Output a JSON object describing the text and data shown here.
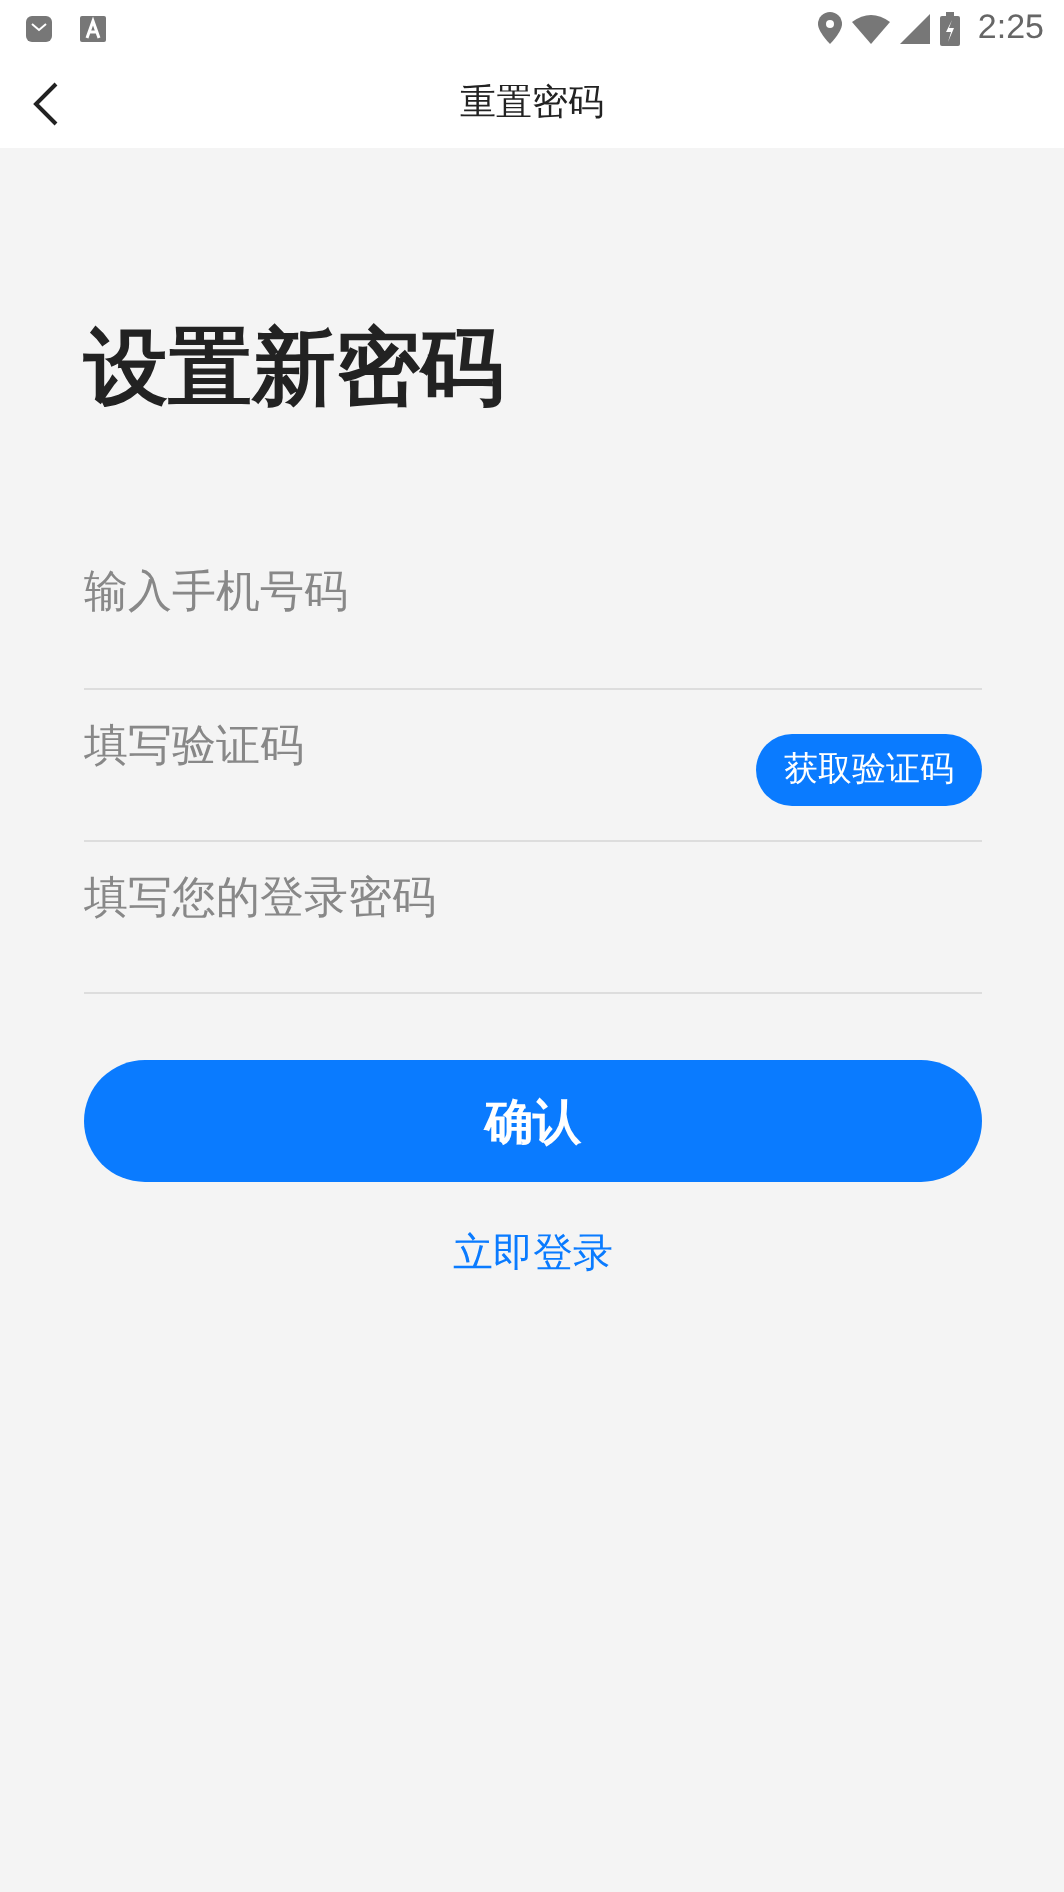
{
  "status_bar": {
    "time": "2:25"
  },
  "nav": {
    "title": "重置密码"
  },
  "heading": "设置新密码",
  "fields": [
    {
      "kind": "plain",
      "placeholder": "输入手机号码"
    },
    {
      "kind": "code",
      "placeholder": "填写验证码",
      "button": "获取验证码"
    },
    {
      "kind": "password",
      "placeholder": "填写您的登录密码"
    }
  ],
  "confirm_button": "确认",
  "login_link": "立即登录"
}
